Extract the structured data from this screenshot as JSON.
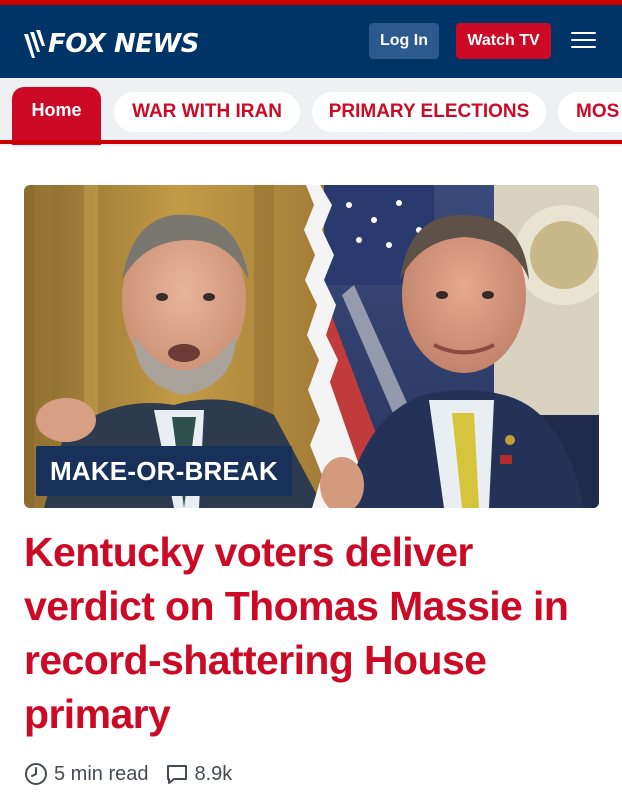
{
  "header": {
    "brand": "FOX NEWS",
    "login_label": "Log In",
    "watch_label": "Watch TV"
  },
  "nav": {
    "tabs": [
      {
        "label": "Home",
        "active": true
      },
      {
        "label": "WAR WITH IRAN",
        "active": false
      },
      {
        "label": "PRIMARY ELECTIONS",
        "active": false
      },
      {
        "label": "MOS",
        "active": false
      }
    ]
  },
  "article": {
    "badge": "MAKE-OR-BREAK",
    "headline": "Kentucky voters deliver verdict on Thomas Massie in record-shattering House primary",
    "read_time": "5 min read",
    "comment_count": "8.9k"
  },
  "icons": {
    "menu": "hamburger-menu-icon",
    "read_time": "clock-icon",
    "comments": "comment-bubble-icon"
  },
  "colors": {
    "header_bg": "#003366",
    "brand_red": "#cc0a26",
    "login_bg": "#2c5a8f",
    "badge_bg": "#17315a",
    "nav_bg": "#eef0f3"
  }
}
